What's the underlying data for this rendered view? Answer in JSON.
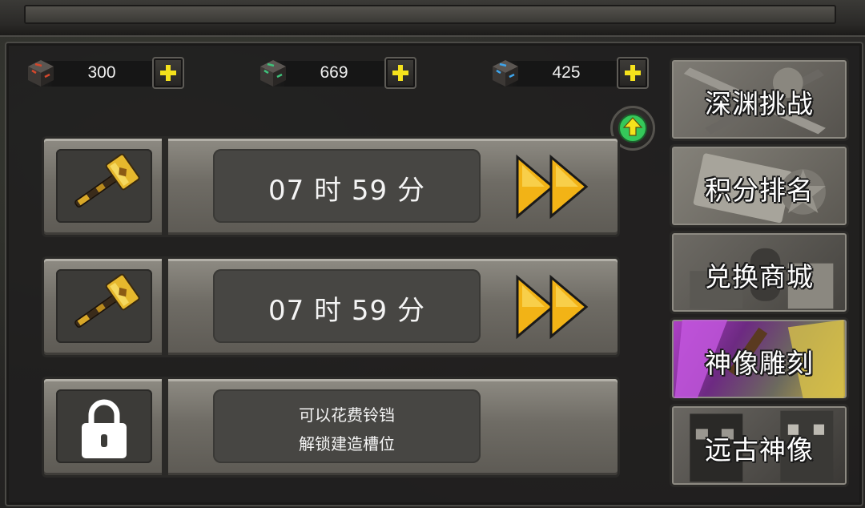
{
  "currencies": [
    {
      "name": "red-cube-currency",
      "value": "300",
      "color": "#c2462f"
    },
    {
      "name": "green-cube-currency",
      "value": "669",
      "color": "#3fae6a"
    },
    {
      "name": "blue-cube-currency",
      "value": "425",
      "color": "#3b9de0"
    }
  ],
  "slots": [
    {
      "icon": "golden-hammer-icon",
      "text": "07 时 59 分",
      "action": "fast-forward-icon"
    },
    {
      "icon": "golden-hammer-icon",
      "text": "07 时 59 分",
      "action": "fast-forward-icon"
    },
    {
      "icon": "lock-icon",
      "line1": "可以花费铃铛",
      "line2": "解锁建造槽位"
    }
  ],
  "menu": [
    {
      "label": "深渊挑战",
      "active": false
    },
    {
      "label": "积分排名",
      "active": false
    },
    {
      "label": "兑换商城",
      "active": false
    },
    {
      "label": "神像雕刻",
      "active": true
    },
    {
      "label": "远古神像",
      "active": false
    }
  ],
  "colors": {
    "accent_yellow": "#f2b316",
    "plus_yellow": "#f5e21c",
    "upgrade_green": "#35c85a",
    "active_purple": "#b040c8"
  }
}
